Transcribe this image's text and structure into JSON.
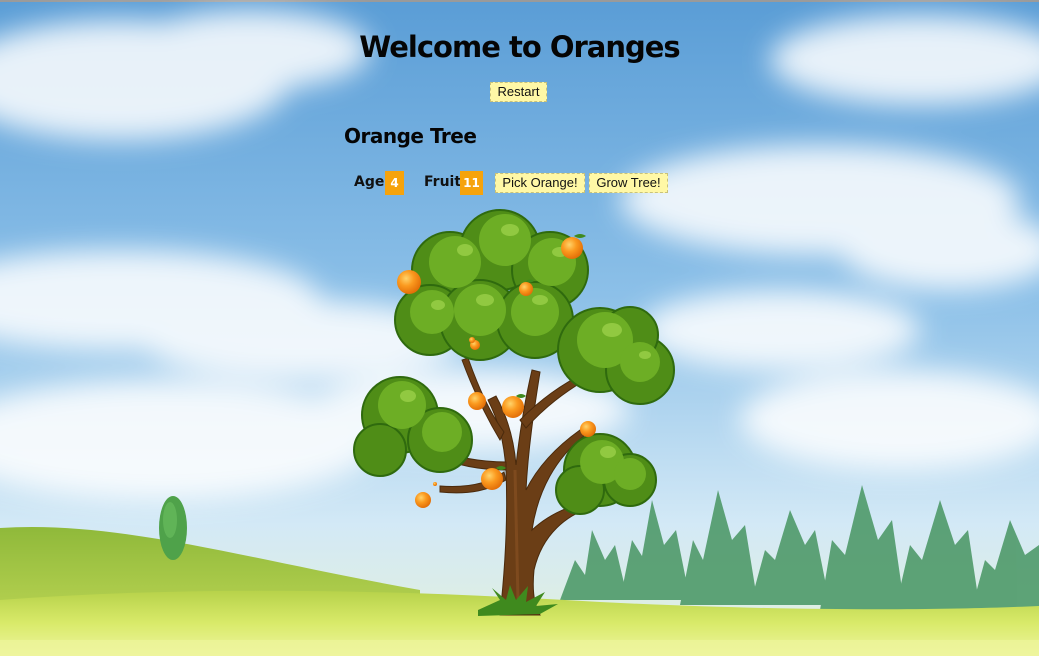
{
  "header": {
    "title": "Welcome to Oranges",
    "restart_label": "Restart"
  },
  "tree_panel": {
    "title": "Orange Tree",
    "age_label": "Age:",
    "age_value": "4",
    "fruit_label": "Fruit:",
    "fruit_value": "11",
    "pick_label": "Pick Orange!",
    "grow_label": "Grow Tree!"
  },
  "colors": {
    "sky_top": "#5a9fd4",
    "sky_bottom": "#cfe6f6",
    "hill_green": "#9fc93a",
    "foliage": "#5c9a1e",
    "trunk": "#6b3e16",
    "orange": "#f5901e",
    "badge": "#f6a30c",
    "button_bg": "#fff8a6"
  },
  "icons": [
    "orange-tree",
    "orange-fruit",
    "pine-tree",
    "cypress-tree",
    "cloud"
  ]
}
